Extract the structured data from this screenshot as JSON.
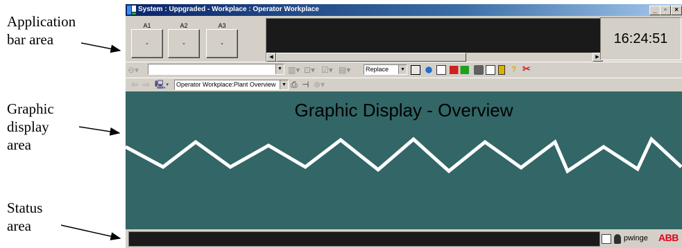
{
  "annotations": {
    "application_bar": "Application\nbar area",
    "graphic_display": "Graphic\ndisplay\narea",
    "status": "Status\narea"
  },
  "window": {
    "title": "System : Uppgraded - Workplace : Operator Workplace",
    "min_label": "_",
    "restore_label": "▫",
    "close_label": "×"
  },
  "app_bar": {
    "buttons": [
      {
        "label": "A1",
        "value": "-"
      },
      {
        "label": "A2",
        "value": "-"
      },
      {
        "label": "A3",
        "value": "-"
      }
    ],
    "clock": "16:24:51"
  },
  "toolbar1": {
    "search_value": "",
    "mode_value": "Replace"
  },
  "toolbar2": {
    "location_value": "Operator Workplace:Plant Overview"
  },
  "graphic": {
    "title": "Graphic Display - Overview",
    "line_color": "#ffffff",
    "background": "#336666"
  },
  "status_bar": {
    "user": "pwinge",
    "logo": "ABB"
  },
  "colors": {
    "title_bar": "#0a246a",
    "chrome": "#d4d0c8",
    "abb_red": "#e2001a"
  }
}
